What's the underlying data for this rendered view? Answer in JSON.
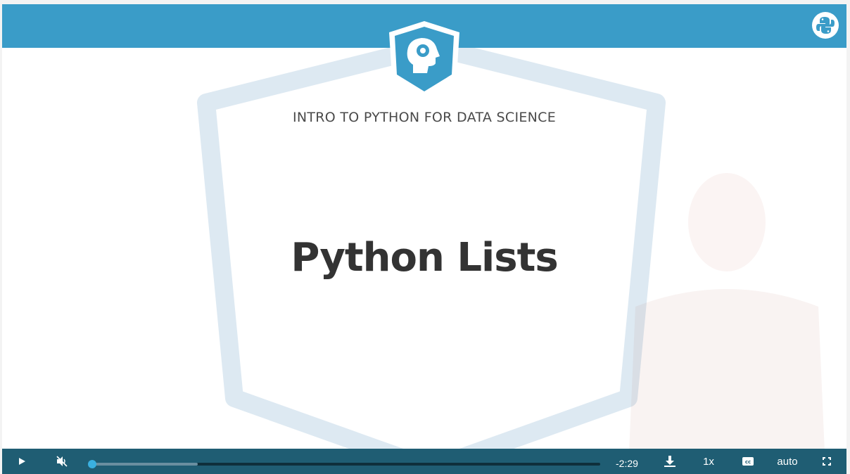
{
  "course": {
    "title": "INTRO TO PYTHON FOR DATA SCIENCE"
  },
  "slide": {
    "title": "Python Lists"
  },
  "colors": {
    "brand_blue": "#3a9cc8",
    "control_bar": "#1f5d73",
    "progress_handle": "#3ab0e0",
    "frame": "#dde9f2"
  },
  "player": {
    "time_remaining": "-2:29",
    "speed": "1x",
    "quality": "auto",
    "buffered_fraction": 0.21,
    "played_fraction": 0.0,
    "muted": true
  },
  "icons": {
    "play": "play-icon",
    "mute": "muted-speaker-icon",
    "download": "download-icon",
    "captions": "cc-icon",
    "fullscreen": "fullscreen-icon",
    "python": "python-logo-icon",
    "badge": "datacamp-head-gear-icon"
  }
}
